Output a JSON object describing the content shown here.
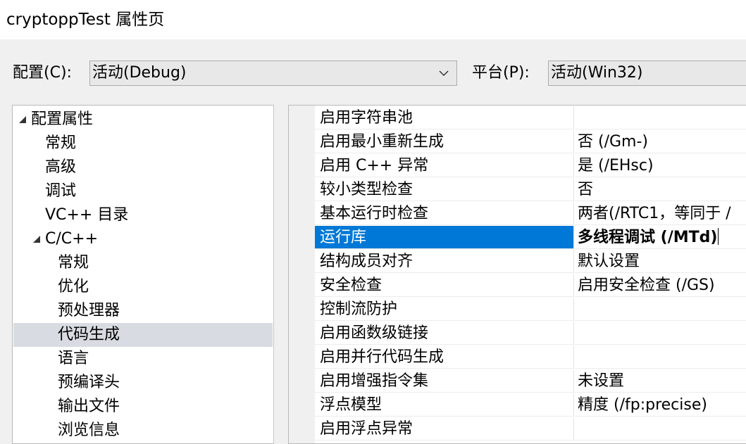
{
  "window": {
    "title": "cryptoppTest 属性页"
  },
  "toolbar": {
    "config_label": "配置(C):",
    "config_value": "活动(Debug)",
    "platform_label": "平台(P):",
    "platform_value": "活动(Win32)"
  },
  "tree": {
    "items": [
      {
        "label": "配置属性",
        "level": 0,
        "expanded": true
      },
      {
        "label": "常规",
        "level": 1
      },
      {
        "label": "高级",
        "level": 1
      },
      {
        "label": "调试",
        "level": 1
      },
      {
        "label": "VC++ 目录",
        "level": 1
      },
      {
        "label": "C/C++",
        "level": 1,
        "expanded": true
      },
      {
        "label": "常规",
        "level": 2
      },
      {
        "label": "优化",
        "level": 2
      },
      {
        "label": "预处理器",
        "level": 2
      },
      {
        "label": "代码生成",
        "level": 2,
        "selected": true
      },
      {
        "label": "语言",
        "level": 2
      },
      {
        "label": "预编译头",
        "level": 2
      },
      {
        "label": "输出文件",
        "level": 2
      },
      {
        "label": "浏览信息",
        "level": 2
      }
    ]
  },
  "properties": {
    "rows": [
      {
        "name": "启用字符串池",
        "value": ""
      },
      {
        "name": "启用最小重新生成",
        "value": "否 (/Gm-)"
      },
      {
        "name": "启用 C++ 异常",
        "value": "是 (/EHsc)"
      },
      {
        "name": "较小类型检查",
        "value": "否"
      },
      {
        "name": "基本运行时检查",
        "value": "两者(/RTC1，等同于 /"
      },
      {
        "name": "运行库",
        "value": "多线程调试 (/MTd)",
        "selected": true
      },
      {
        "name": "结构成员对齐",
        "value": "默认设置"
      },
      {
        "name": "安全检查",
        "value": "启用安全检查 (/GS)"
      },
      {
        "name": "控制流防护",
        "value": ""
      },
      {
        "name": "启用函数级链接",
        "value": ""
      },
      {
        "name": "启用并行代码生成",
        "value": ""
      },
      {
        "name": "启用增强指令集",
        "value": "未设置"
      },
      {
        "name": "浮点模型",
        "value": "精度 (/fp:precise)"
      },
      {
        "name": "启用浮点异常",
        "value": ""
      }
    ]
  },
  "colors": {
    "selection": "#0078d7",
    "tree_selection": "#d8dce2"
  }
}
